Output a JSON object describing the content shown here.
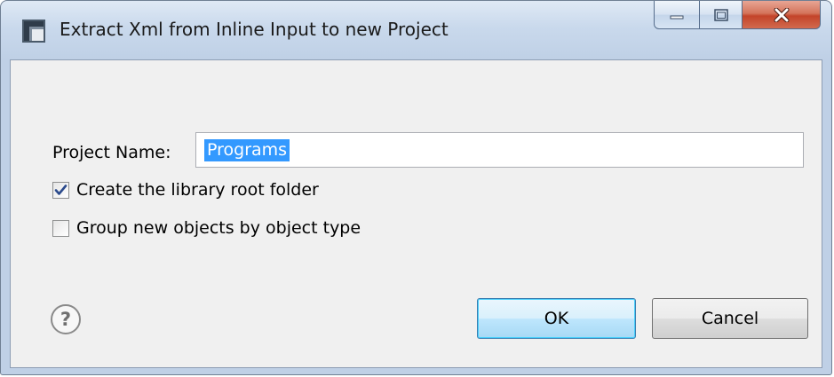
{
  "window": {
    "title": "Extract Xml from Inline Input to new Project",
    "icon": "eclipse-wizard-icon",
    "caption_buttons": [
      "minimize-icon",
      "maximize-icon",
      "close-icon"
    ]
  },
  "form": {
    "project_name_label": "Project Name:",
    "project_name_value": "Programs",
    "checkboxes": [
      {
        "label": "Create the library root folder",
        "checked": true
      },
      {
        "label": "Group new objects by object type",
        "checked": false
      }
    ]
  },
  "footer": {
    "help_icon": "help-icon",
    "ok_label": "OK",
    "cancel_label": "Cancel"
  },
  "colors": {
    "selection": "#3399ff",
    "checkmark": "#2b4a8c",
    "close_button": "#c3442a",
    "dialog_body": "#f0f0f0"
  }
}
